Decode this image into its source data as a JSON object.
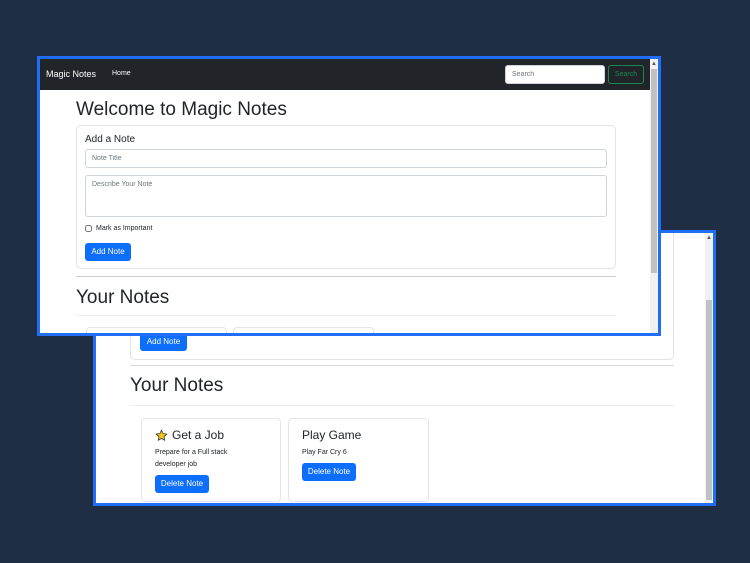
{
  "app": {
    "brand": "Magic Notes",
    "nav_home": "Home",
    "search_placeholder": "Search",
    "search_button": "Search"
  },
  "form": {
    "heading": "Welcome to Magic Notes",
    "card_label": "Add a Note",
    "title_placeholder": "Note Title",
    "title_value": "",
    "desc_placeholder": "Describe Your Note",
    "desc_value": "",
    "important_label": "Mark as Important",
    "important_checked": false,
    "add_button": "Add Note"
  },
  "notes_section": {
    "heading": "Your Notes",
    "notes": [
      {
        "title": "Get a Job",
        "text": "Prepare for a Full stack developer job",
        "important": true,
        "icon": "star-icon",
        "delete_label": "Delete Note"
      },
      {
        "title": "Play Game",
        "text": "Play Far Cry 6",
        "important": false,
        "icon": "",
        "delete_label": "Delete Note"
      }
    ]
  },
  "colors": {
    "background": "#1f2d45",
    "window_border": "#1f6ef5",
    "navbar": "#212529",
    "primary": "#0d6efd",
    "search_outline": "#198754",
    "star": "#f5c518"
  }
}
